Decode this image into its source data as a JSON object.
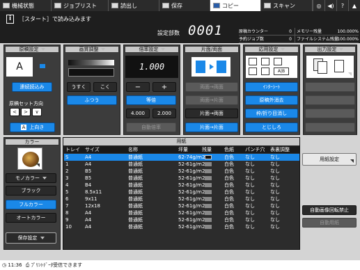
{
  "tabs": [
    {
      "label": "機械状態",
      "icon": "machine-icon"
    },
    {
      "label": "ジョブリスト",
      "icon": "joblist-icon"
    },
    {
      "label": "読出し",
      "icon": "recall-icon"
    },
    {
      "label": "保存",
      "icon": "save-icon"
    },
    {
      "label": "コピー",
      "icon": "copy-icon",
      "active": true
    },
    {
      "label": "スキャン",
      "icon": "scan-icon"
    }
  ],
  "toolbar_buttons": [
    "◎",
    "◀)",
    "?",
    "▲"
  ],
  "message": "［スタート］で読み込みます",
  "sets": {
    "label": "設定部数",
    "value": "0001"
  },
  "counters": [
    {
      "label": "原稿カウンター",
      "value": "0",
      "label2": "メモリー残量",
      "value2": "100.000%"
    },
    {
      "label": "予約ジョブ数",
      "value": "0",
      "label2": "ファイルシステム残量",
      "value2": "100.000%"
    }
  ],
  "original": {
    "header": "原稿設定",
    "continuous": "連続読込み",
    "direction_label": "原稿セット方向",
    "direction_value": "上向き"
  },
  "quality": {
    "header": "画質調整",
    "lighter": "うすく",
    "darker": "こく",
    "normal": "ふつう"
  },
  "zoom": {
    "header": "倍率設定",
    "value": "1.000",
    "minus": "−",
    "plus": "+",
    "equal": "等倍",
    "preset1": "4.000",
    "preset2": "2.000",
    "auto": "自動倍率"
  },
  "duplex": {
    "header": "片面/両面",
    "b1": "両面→両面",
    "b2": "両面→片面",
    "b3": "片面→両面",
    "b4": "片面→片面"
  },
  "application": {
    "header": "応用設定",
    "b1": "ｲﾝﾀｰｼｰﾄ",
    "b2": "原稿外消去",
    "b3": "枠/折り目消し",
    "b4": "とじしろ"
  },
  "output": {
    "header": "出力設定"
  },
  "color": {
    "header": "カラー",
    "mono": "モノカラー",
    "black": "ブラック",
    "full": "フルカラー",
    "auto": "オートカラー",
    "save": "保存設定"
  },
  "paper": {
    "title": "用紙",
    "columns": [
      "トレイ",
      "サイズ",
      "名称",
      "坪量",
      "残量",
      "色紙",
      "パンチ穴",
      "表裏調整"
    ],
    "rows": [
      {
        "tray": "S",
        "size": "A4",
        "name": "普通紙",
        "weight": "62-74g/m2",
        "color": "白色",
        "punch": "なし",
        "adj": "なし",
        "selected": true
      },
      {
        "tray": "1",
        "size": "A4",
        "name": "普通紙",
        "weight": "52-61g/m2",
        "color": "白色",
        "punch": "なし",
        "adj": "なし"
      },
      {
        "tray": "2",
        "size": "B5",
        "name": "普通紙",
        "weight": "52-61g/m2",
        "color": "白色",
        "punch": "なし",
        "adj": "なし"
      },
      {
        "tray": "3",
        "size": "B5",
        "name": "普通紙",
        "weight": "52-61g/m2",
        "color": "白色",
        "punch": "なし",
        "adj": "なし"
      },
      {
        "tray": "4",
        "size": "B4",
        "name": "普通紙",
        "weight": "52-61g/m2",
        "color": "白色",
        "punch": "なし",
        "adj": "なし"
      },
      {
        "tray": "5",
        "size": "8.5x11",
        "name": "普通紙",
        "weight": "52-61g/m2",
        "color": "白色",
        "punch": "なし",
        "adj": "なし"
      },
      {
        "tray": "6",
        "size": "9x11",
        "name": "普通紙",
        "weight": "52-61g/m2",
        "color": "白色",
        "punch": "なし",
        "adj": "なし"
      },
      {
        "tray": "7",
        "size": "12x18",
        "name": "普通紙",
        "weight": "52-61g/m2",
        "color": "白色",
        "punch": "なし",
        "adj": "なし"
      },
      {
        "tray": "8",
        "size": "A4",
        "name": "普通紙",
        "weight": "52-61g/m2",
        "color": "白色",
        "punch": "なし",
        "adj": "なし"
      },
      {
        "tray": "9",
        "size": "A4",
        "name": "普通紙",
        "weight": "52-61g/m2",
        "color": "白色",
        "punch": "なし",
        "adj": "なし"
      },
      {
        "tray": "10",
        "size": "A4",
        "name": "普通紙",
        "weight": "52-61g/m2",
        "color": "白色",
        "punch": "なし",
        "adj": "なし"
      }
    ]
  },
  "side": {
    "paper_settings": "用紙設定",
    "auto_rotate_off": "自動画像回転禁止",
    "auto_paper": "自動用紙"
  },
  "status": {
    "time": "11:36",
    "message": "ﾌﾟﾘﾝﾄﾃﾞｰﾀ受信できます"
  },
  "colors": {
    "accent": "#1a88e8",
    "bg": "#d4d4d4",
    "panel": "#3c3c3c"
  }
}
